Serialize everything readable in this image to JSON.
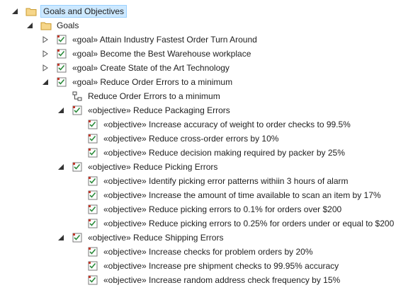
{
  "tree": {
    "root": {
      "label": "Goals and Objectives",
      "expanded": true,
      "selected": true,
      "icon": "folder-icon"
    },
    "goals_folder": {
      "label": "Goals",
      "expanded": true,
      "icon": "folder-icon"
    },
    "goal1": {
      "label": "«goal» Attain Industry Fastest Order Turn Around",
      "expanded": false,
      "icon": "requirement-icon"
    },
    "goal2": {
      "label": "«goal» Become the Best Warehouse workplace",
      "expanded": false,
      "icon": "requirement-icon"
    },
    "goal3": {
      "label": "«goal» Create State of the Art Technology",
      "expanded": false,
      "icon": "requirement-icon"
    },
    "goal4": {
      "label": "«goal» Reduce Order Errors to a minimum",
      "expanded": true,
      "icon": "requirement-icon"
    },
    "goal4_diagram": {
      "label": "Reduce Order Errors to a minimum",
      "icon": "diagram-icon"
    },
    "obj_packaging": {
      "label": "«objective» Reduce Packaging Errors",
      "expanded": true,
      "children": [
        "«objective» Increase accuracy of weight to order checks to 99.5%",
        "«objective» Reduce cross-order errors by 10%",
        "«objective» Reduce decision making required by packer by 25%"
      ]
    },
    "obj_picking": {
      "label": "«objective» Reduce Picking Errors",
      "expanded": true,
      "children": [
        "«objective» Identify picking error patterns withiin 3 hours  of alarm",
        "«objective» Increase the amount of time available to scan an item by 17%",
        "«objective» Reduce picking errors to 0.1% for orders over $200",
        "«objective» Reduce picking errors to 0.25% for orders under or equal to $200"
      ]
    },
    "obj_shipping": {
      "label": "«objective» Reduce Shipping Errors",
      "expanded": true,
      "children": [
        "«objective» Increase checks for problem orders by 20%",
        "«objective» Increase pre shipment checks to 99.95% accuracy",
        "«objective» Increase random address check frequency by 15%"
      ]
    }
  },
  "colors": {
    "selection_bg": "#cce8ff",
    "selection_border": "#99d1ff",
    "folder": "#f3c96b",
    "goal_check": "#2a8a3a",
    "goal_flag": "#c0392b"
  }
}
